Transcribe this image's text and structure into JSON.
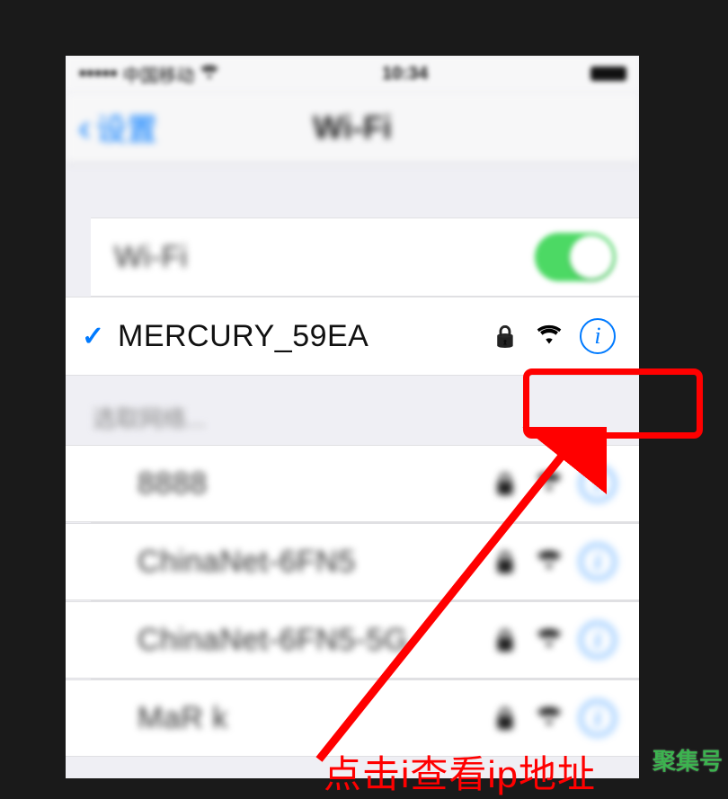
{
  "status_bar": {
    "carrier": "中国移动",
    "time": "10:34"
  },
  "nav": {
    "back_label": "设置",
    "title": "Wi-Fi"
  },
  "wifi_toggle": {
    "label": "Wi-Fi",
    "on": true
  },
  "connected": {
    "ssid": "MERCURY_59EA",
    "locked": true
  },
  "choose_network_label": "选取网络...",
  "networks": [
    {
      "ssid": "8888",
      "locked": true
    },
    {
      "ssid": "ChinaNet-6FN5",
      "locked": true
    },
    {
      "ssid": "ChinaNet-6FN5-5G",
      "locked": true
    },
    {
      "ssid": "MaR k",
      "locked": true
    }
  ],
  "annotation": {
    "text": "点击i查看ip地址"
  },
  "watermark": "聚集号"
}
